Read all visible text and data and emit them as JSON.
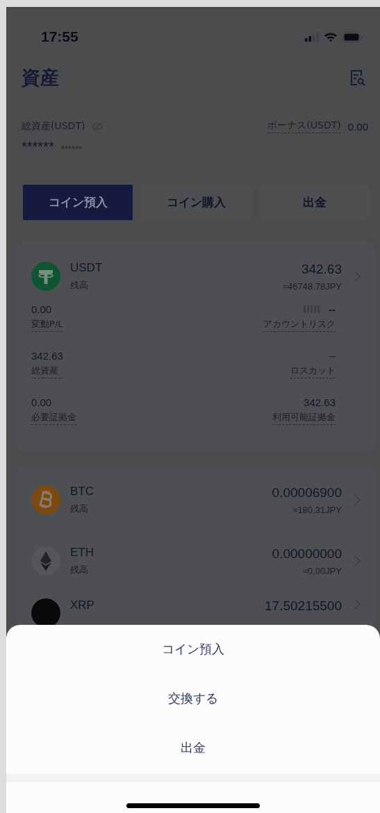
{
  "status_bar": {
    "time": "17:55"
  },
  "header": {
    "title": "資産"
  },
  "summary": {
    "total_label": "総資産(USDT)",
    "total_value": "******",
    "total_sub": "******",
    "bonus_label": "ボーナス(USDT)",
    "bonus_value": "0.00"
  },
  "actions": [
    {
      "label": "コイン預入",
      "selected": true
    },
    {
      "label": "コイン購入",
      "selected": false
    },
    {
      "label": "出金",
      "selected": false
    }
  ],
  "usdt_card": {
    "coin": {
      "symbol": "USDT",
      "kind": "usdt",
      "label": "残高",
      "amount": "342.63",
      "fiat": "≈46748.78JPY"
    },
    "stats": [
      {
        "left_value": "0.00",
        "left_label": "変動P/L",
        "right_value": "--",
        "right_label": "アカウントリスク",
        "kind": "risk"
      },
      {
        "left_value": "342.63",
        "left_label": "総資産",
        "right_value": "--",
        "right_label": "ロスカット",
        "kind": "plain"
      },
      {
        "left_value": "0.00",
        "left_label": "必要証拠金",
        "right_value": "342.63",
        "right_label": "利用可能証拠金",
        "kind": "plain"
      }
    ]
  },
  "coins": [
    {
      "symbol": "BTC",
      "kind": "btc",
      "label": "残高",
      "amount": "0.00006900",
      "fiat": "≈180.31JPY"
    },
    {
      "symbol": "ETH",
      "kind": "eth",
      "label": "残高",
      "amount": "0.00000000",
      "fiat": "≈0.00JPY"
    },
    {
      "symbol": "XRP",
      "kind": "xrp",
      "amount": "17.50215500"
    }
  ],
  "action_sheet": {
    "items": [
      "コイン預入",
      "交換する",
      "出金"
    ]
  }
}
